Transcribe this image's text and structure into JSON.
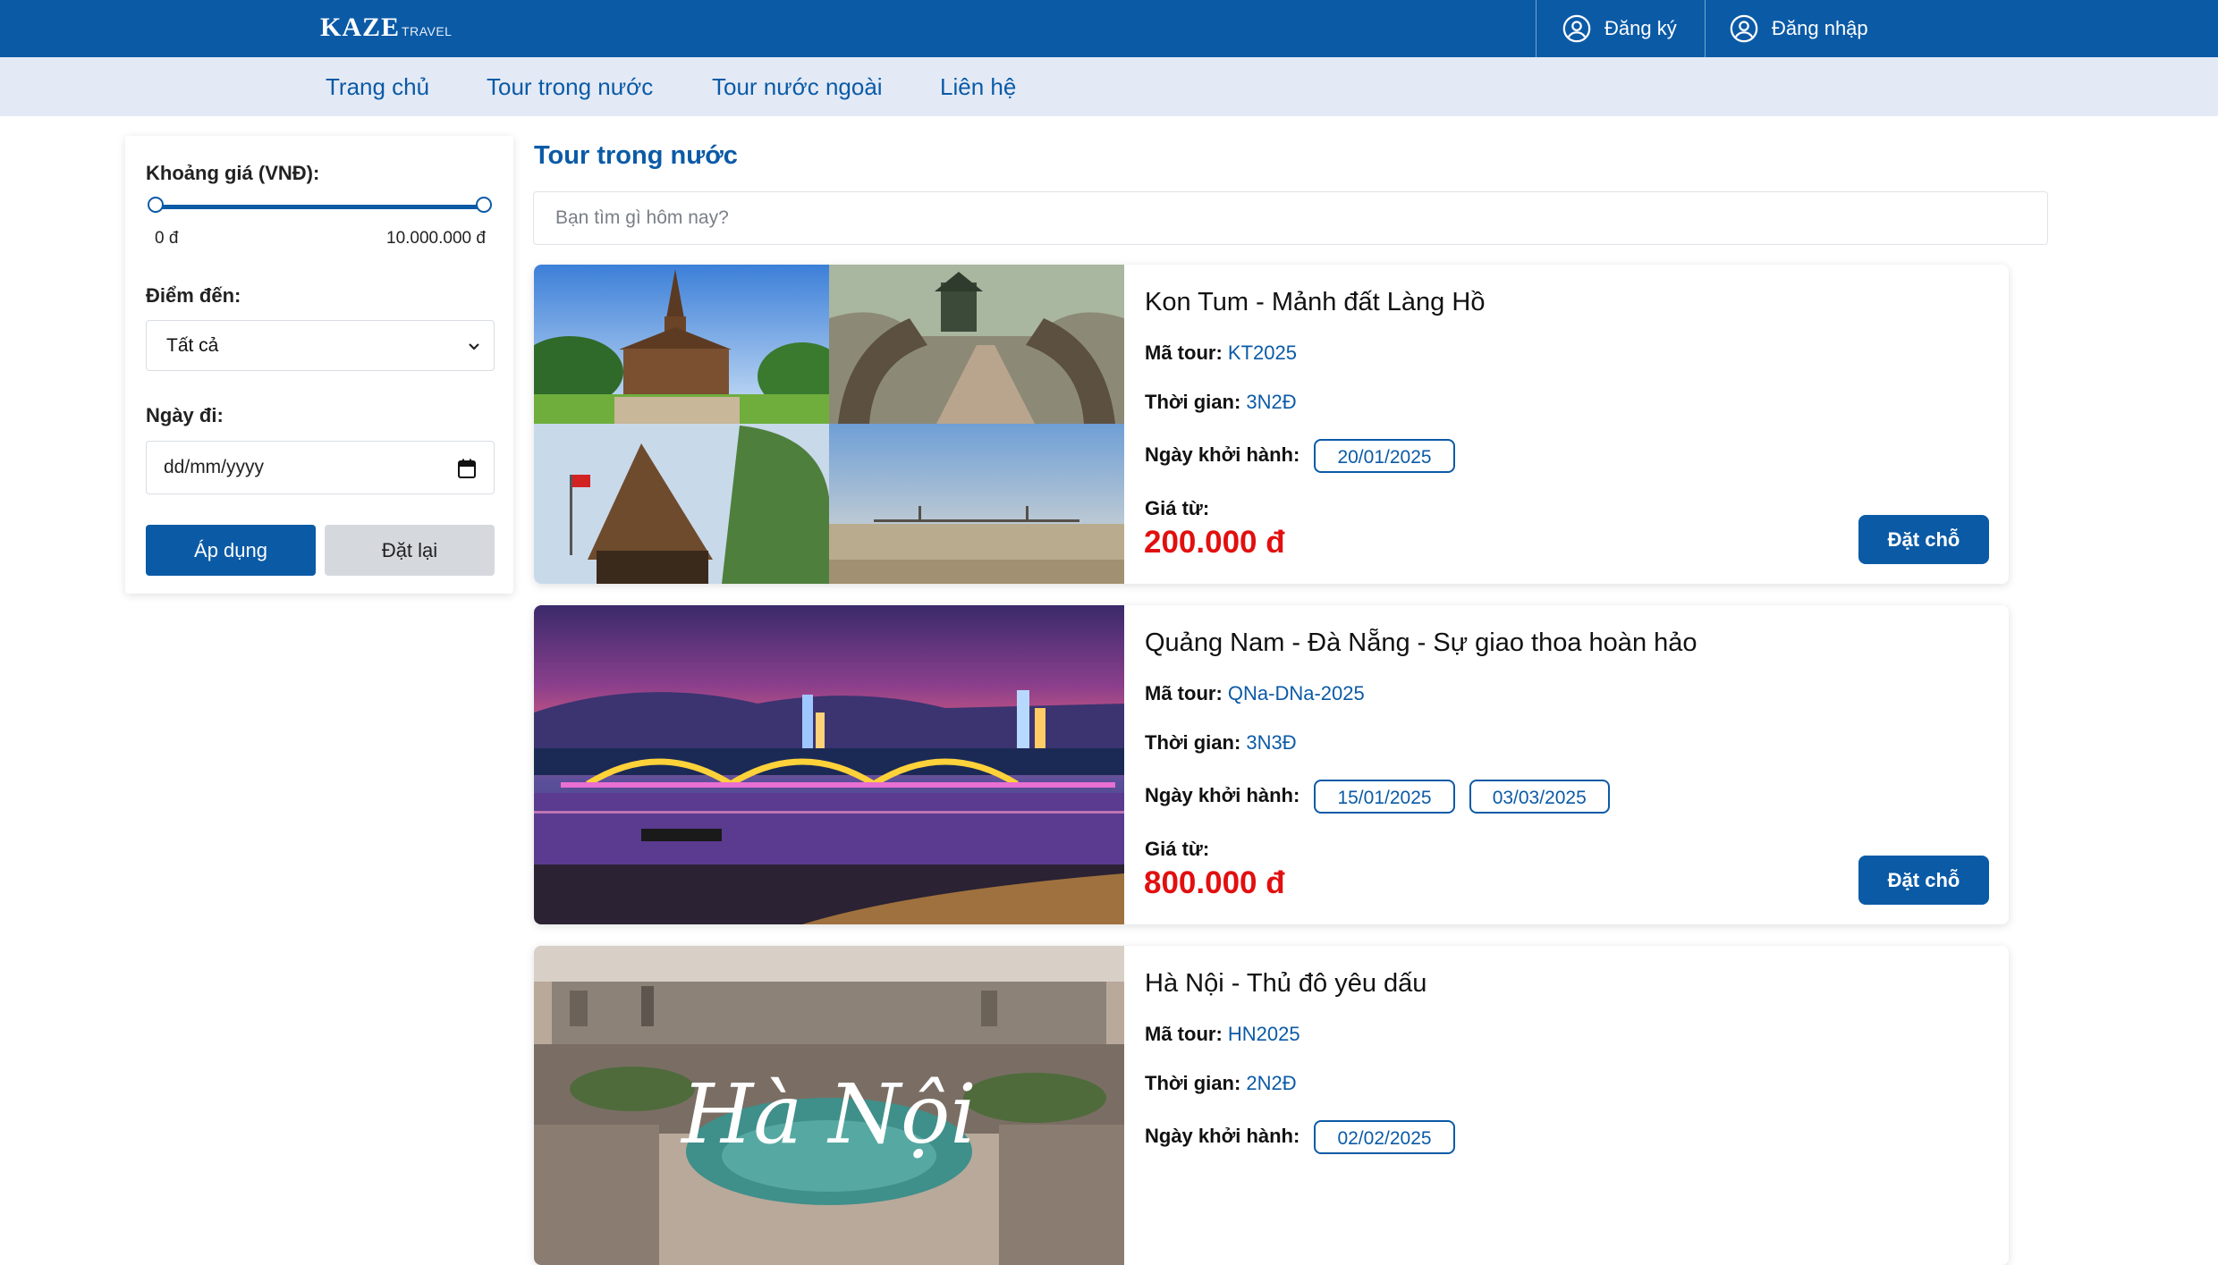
{
  "brand": {
    "name": "KAZE",
    "sub": "TRAVEL"
  },
  "header": {
    "register_label": "Đăng ký",
    "login_label": "Đăng nhập"
  },
  "nav": {
    "items": [
      {
        "label": "Trang chủ"
      },
      {
        "label": "Tour trong nước"
      },
      {
        "label": "Tour nước ngoài"
      },
      {
        "label": "Liên hệ"
      }
    ]
  },
  "filter": {
    "price_label": "Khoảng giá (VNĐ):",
    "price_min": "0 đ",
    "price_max": "10.000.000 đ",
    "destination_label": "Điểm đến:",
    "destination_value": "Tất cả",
    "date_label": "Ngày đi:",
    "date_placeholder": "dd/mm/yyyy",
    "apply_label": "Áp dụng",
    "reset_label": "Đặt lại"
  },
  "main": {
    "title": "Tour trong nước",
    "search_placeholder": "Bạn tìm gì hôm nay?",
    "tours": [
      {
        "name": "Kon Tum - Mảnh đất Làng Hồ",
        "code_label": "Mã tour:",
        "code": "KT2025",
        "duration_label": "Thời gian:",
        "duration": "3N2Đ",
        "dates_label": "Ngày khởi hành:",
        "dates": [
          "20/01/2025"
        ],
        "price_label": "Giá từ:",
        "price": "200.000 đ",
        "book_label": "Đặt chỗ"
      },
      {
        "name": "Quảng Nam - Đà Nẵng - Sự giao thoa hoàn hảo",
        "code_label": "Mã tour:",
        "code": "QNa-DNa-2025",
        "duration_label": "Thời gian:",
        "duration": "3N3Đ",
        "dates_label": "Ngày khởi hành:",
        "dates": [
          "15/01/2025",
          "03/03/2025"
        ],
        "price_label": "Giá từ:",
        "price": "800.000 đ",
        "book_label": "Đặt chỗ"
      },
      {
        "name": "Hà Nội - Thủ đô yêu dấu",
        "code_label": "Mã tour:",
        "code": "HN2025",
        "duration_label": "Thời gian:",
        "duration": "2N2Đ",
        "dates_label": "Ngày khởi hành:",
        "dates": [
          "02/02/2025"
        ],
        "photo_caption": "Hà Nội"
      }
    ]
  },
  "colors": {
    "primary": "#0b5aa6",
    "nav_bg": "#e3eaf6",
    "price": "#e20f0f"
  }
}
